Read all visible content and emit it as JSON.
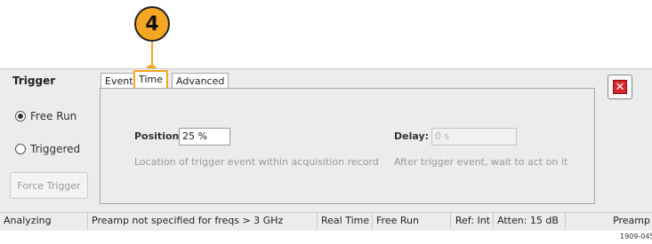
{
  "callout": {
    "number": "4"
  },
  "sidebar": {
    "title": "Trigger",
    "options": [
      {
        "label": "Free Run",
        "selected": true
      },
      {
        "label": "Triggered",
        "selected": false
      }
    ],
    "force_trigger_label": "Force Trigger"
  },
  "tabs": [
    {
      "label": "Event",
      "active": false
    },
    {
      "label": "Time",
      "active": true
    },
    {
      "label": "Advanced",
      "active": false
    }
  ],
  "position": {
    "label": "Position:",
    "value": "25 %",
    "hint": "Location of trigger event within acquisition record"
  },
  "delay": {
    "label": "Delay:",
    "value": "0 s",
    "hint": "After trigger event, wait to act on it"
  },
  "status_bar": {
    "mode": "Analyzing",
    "message": "Preamp not specified for freqs > 3 GHz",
    "realtime": "Real Time",
    "trigger": "Free Run",
    "ref": "Ref: Int",
    "atten": "Atten: 15 dB",
    "preamp": "Preamp"
  },
  "figure_id": "1909-045",
  "colors": {
    "callout": "#f5a623",
    "close_icon": "#d9262c"
  }
}
